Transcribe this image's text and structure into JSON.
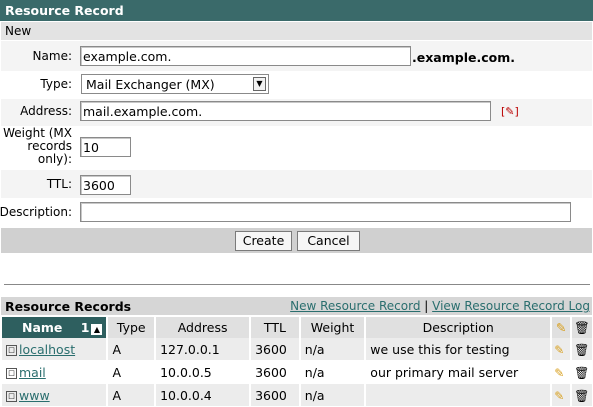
{
  "header": {
    "title": "Resource Record"
  },
  "form": {
    "section_label": "New",
    "name_label": "Name:",
    "name_value": "example.com.",
    "name_suffix": ".example.com.",
    "type_label": "Type:",
    "type_value": "Mail Exchanger (MX)",
    "address_label": "Address:",
    "address_value": "mail.example.com.",
    "weight_label_line1": "Weight (MX",
    "weight_label_line2": "records",
    "weight_label_line3": "only):",
    "weight_value": "10",
    "ttl_label": "TTL:",
    "ttl_value": "3600",
    "description_label": "Description:",
    "description_value": "",
    "create_label": "Create",
    "cancel_label": "Cancel"
  },
  "records": {
    "title": "Resource Records",
    "new_link": "New Resource Record",
    "separator": "|",
    "log_link": "View Resource Record Log",
    "columns": {
      "name": "Name",
      "sort_num": "1",
      "type": "Type",
      "address": "Address",
      "ttl": "TTL",
      "weight": "Weight",
      "description": "Description"
    },
    "rows": [
      {
        "name": "localhost",
        "type": "A",
        "address": "127.0.0.1",
        "ttl": "3600",
        "weight": "n/a",
        "description": "we use this for testing"
      },
      {
        "name": "mail",
        "type": "A",
        "address": "10.0.0.5",
        "ttl": "3600",
        "weight": "n/a",
        "description": "our primary mail server"
      },
      {
        "name": "www",
        "type": "A",
        "address": "10.0.0.4",
        "ttl": "3600",
        "weight": "n/a",
        "description": ""
      }
    ]
  }
}
